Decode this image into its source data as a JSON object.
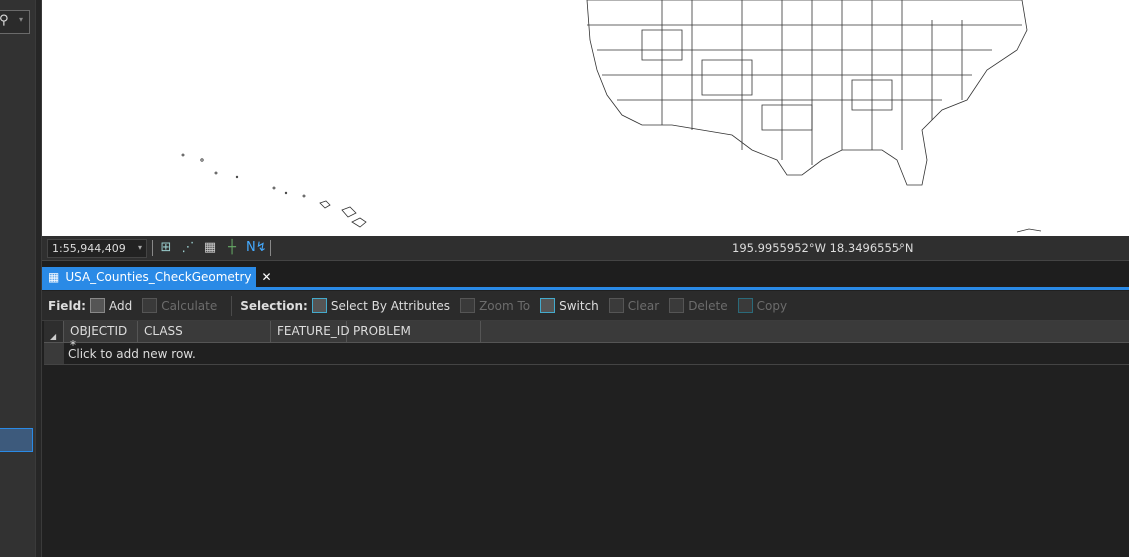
{
  "map": {
    "scale": "1:55,944,409",
    "coordinates": "195.9955952°W 18.3496555°N"
  },
  "table_tab": {
    "title": "USA_Counties_CheckGeometry"
  },
  "toolbar": {
    "field_label": "Field:",
    "add": "Add",
    "calculate": "Calculate",
    "selection_label": "Selection:",
    "select_by_attributes": "Select By Attributes",
    "zoom_to": "Zoom To",
    "switch": "Switch",
    "clear": "Clear",
    "delete": "Delete",
    "copy": "Copy"
  },
  "table": {
    "columns": [
      "OBJECTID *",
      "CLASS",
      "FEATURE_ID",
      "PROBLEM"
    ],
    "new_row": "Click to add new row."
  },
  "colors": {
    "accent": "#2a8ae6"
  }
}
